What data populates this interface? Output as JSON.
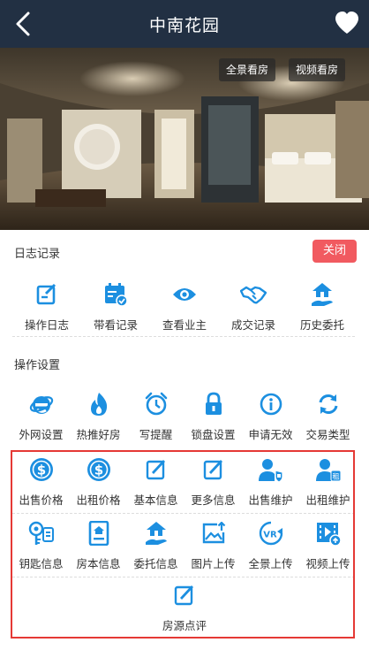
{
  "header": {
    "title": "中南花园"
  },
  "photo": {
    "pano_button": "全景看房",
    "video_button": "视频看房"
  },
  "log_section": {
    "title": "日志记录",
    "close_label": "关闭",
    "items": [
      {
        "label": "操作日志",
        "icon": "edit-log-icon"
      },
      {
        "label": "带看记录",
        "icon": "calendar-check-icon"
      },
      {
        "label": "查看业主",
        "icon": "eye-icon"
      },
      {
        "label": "成交记录",
        "icon": "handshake-icon"
      },
      {
        "label": "历史委托",
        "icon": "house-hand-icon"
      }
    ]
  },
  "ops_section": {
    "title": "操作设置",
    "row1": [
      {
        "label": "外网设置",
        "icon": "ie-icon"
      },
      {
        "label": "热推好房",
        "icon": "fire-icon"
      },
      {
        "label": "写提醒",
        "icon": "alarm-icon"
      },
      {
        "label": "锁盘设置",
        "icon": "lock-icon"
      },
      {
        "label": "申请无效",
        "icon": "info-icon"
      },
      {
        "label": "交易类型",
        "icon": "refresh-icon"
      }
    ],
    "row2": [
      {
        "label": "出售价格",
        "icon": "dollar-icon"
      },
      {
        "label": "出租价格",
        "icon": "dollar-icon"
      },
      {
        "label": "基本信息",
        "icon": "edit-icon"
      },
      {
        "label": "更多信息",
        "icon": "edit-icon"
      },
      {
        "label": "出售维护",
        "icon": "user-shield-icon"
      },
      {
        "label": "出租维护",
        "icon": "user-rent-icon"
      }
    ],
    "row3": [
      {
        "label": "钥匙信息",
        "icon": "key-icon"
      },
      {
        "label": "房本信息",
        "icon": "deed-icon"
      },
      {
        "label": "委托信息",
        "icon": "house-hand-icon"
      },
      {
        "label": "图片上传",
        "icon": "image-upload-icon"
      },
      {
        "label": "全景上传",
        "icon": "vr-icon"
      },
      {
        "label": "视频上传",
        "icon": "video-upload-icon"
      }
    ],
    "row4": [
      {
        "label": "房源点评",
        "icon": "edit-icon"
      }
    ]
  },
  "colors": {
    "header_bg": "#223043",
    "accent": "#1c8fe0",
    "close_bg": "#f15a60",
    "highlight_border": "#e53935"
  }
}
